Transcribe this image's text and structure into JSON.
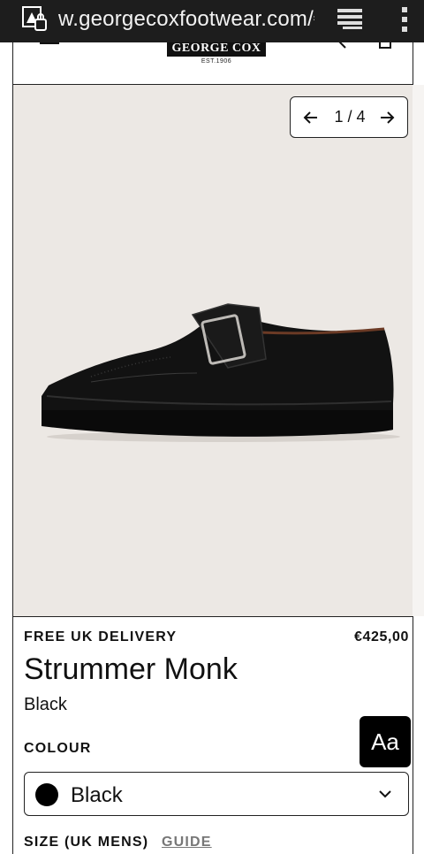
{
  "browser": {
    "url": "w.georgecoxfootwear.com/€",
    "site_icon": "site-security-icon",
    "tabs_icon": "tabs-icon",
    "menu_icon": "kebab-menu-icon"
  },
  "header": {
    "logo": "GEORGE COX",
    "est": "EST.1906"
  },
  "gallery": {
    "counter": "1 / 4",
    "prev_icon": "arrow-left-icon",
    "next_icon": "arrow-right-icon"
  },
  "product": {
    "delivery": "FREE UK DELIVERY",
    "price": "€425,00",
    "name": "Strummer Monk",
    "variant": "Black",
    "colour_label": "COLOUR",
    "colour_selected": "Black",
    "text_size_button": "Aa",
    "size_label": "SIZE (UK MENS)",
    "guide_link": "GUIDE"
  },
  "colors": {
    "status_bar": "#1d1d1d",
    "image_bg": "#ece8e4",
    "accent": "#000000"
  }
}
